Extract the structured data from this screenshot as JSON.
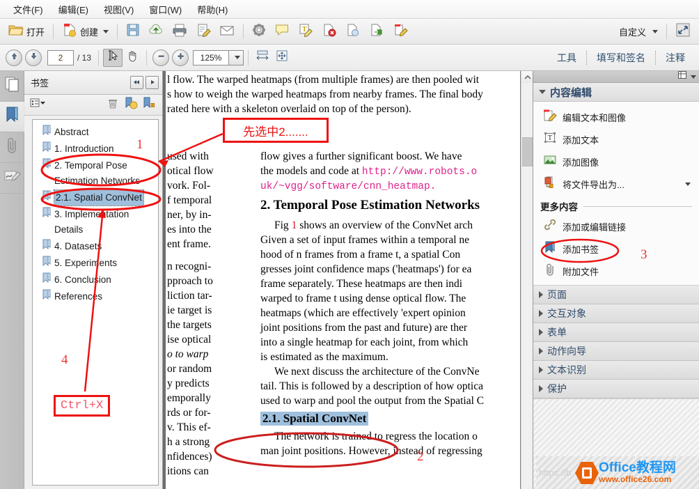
{
  "menubar": {
    "items": [
      {
        "label": "文件(F)",
        "name": "menu-file"
      },
      {
        "label": "编辑(E)",
        "name": "menu-edit"
      },
      {
        "label": "视图(V)",
        "name": "menu-view"
      },
      {
        "label": "窗口(W)",
        "name": "menu-window"
      },
      {
        "label": "帮助(H)",
        "name": "menu-help"
      }
    ]
  },
  "toolbar": {
    "open_label": "打开",
    "create_label": "创建",
    "customize_label": "自定义",
    "icons": [
      "save-icon",
      "upload-cloud-icon",
      "print-icon",
      "sign-icon",
      "email-icon",
      "settings-icon",
      "comment-icon",
      "highlight-text-icon",
      "delete-page-icon",
      "copy-page-icon",
      "export-page-icon",
      "edit-page-icon"
    ],
    "fullscreen_icon": "fullscreen-icon"
  },
  "navbar": {
    "prev_page_icon": "arrow-up-icon",
    "next_page_icon": "arrow-down-icon",
    "page_current": "2",
    "page_total": "/ 13",
    "select_tool_icon": "select-text-icon",
    "hand_tool_icon": "hand-icon",
    "zoom_out_icon": "minus-icon",
    "zoom_in_icon": "plus-icon",
    "zoom_value": "125%",
    "fit_width_icon": "fit-width-icon",
    "fit_page_icon": "fit-page-icon",
    "tabs": [
      {
        "label": "工具",
        "name": "nav-tab-tools"
      },
      {
        "label": "填写和签名",
        "name": "nav-tab-fill-sign"
      },
      {
        "label": "注释",
        "name": "nav-tab-comment"
      }
    ]
  },
  "rail": {
    "items": [
      {
        "name": "sidebar-rail-pages",
        "icon": "pages-thumbnail-icon",
        "active": false
      },
      {
        "name": "sidebar-rail-bookmarks",
        "icon": "bookmark-icon",
        "active": true
      },
      {
        "name": "sidebar-rail-attachments",
        "icon": "paperclip-icon",
        "active": false
      },
      {
        "name": "sidebar-rail-signatures",
        "icon": "signature-icon",
        "active": false
      }
    ]
  },
  "bookmarks_panel": {
    "title": "书签",
    "nav_prev_icon": "collapse-left-icon",
    "nav_next_icon": "expand-right-icon",
    "options_icon": "options-list-icon",
    "delete_icon": "trash-icon",
    "new_bookmark_icon": "new-bookmark-icon",
    "edit_bookmark_icon": "goto-bookmark-icon",
    "items": [
      {
        "label": "Abstract",
        "selected": false
      },
      {
        "label": "1. Introduction",
        "selected": false
      },
      {
        "label": "2. Temporal Pose Estimation Networks",
        "selected": false
      },
      {
        "label": "2.1. Spatial ConvNet",
        "selected": true
      },
      {
        "label": "3. Implementation Details",
        "selected": false
      },
      {
        "label": "4. Datasets",
        "selected": false
      },
      {
        "label": "5. Experiments",
        "selected": false
      },
      {
        "label": "6. Conclusion",
        "selected": false
      },
      {
        "label": "References",
        "selected": false
      }
    ]
  },
  "document": {
    "top_lines": [
      "l flow. The warped heatmaps (from multiple frames) are then pooled wit",
      "s how to weigh the warped heatmaps from nearby frames. The final body",
      "rated here with a skeleton overlaid on top of the person)."
    ],
    "left_column": [
      "used with",
      "otical flow",
      "vork. Fol-",
      "f temporal",
      "ner, by in-",
      "es into the",
      "ent frame.",
      "n recogni-",
      "pproach to",
      "liction tar-",
      "ie target is",
      "the targets",
      "ise optical",
      "o to warp",
      "or random",
      "y predicts",
      "emporally",
      "rds or for-",
      "v. This ef-",
      "h a strong",
      "nfidences)",
      "itions can"
    ],
    "right_column_para1": [
      "flow gives a further significant boost.  We have",
      "the models and code at "
    ],
    "right_column_link1": "http://www.robots.o",
    "right_column_link2": "uk/~vgg/software/cnn_heatmap.",
    "heading_2": "2. Temporal Pose Estimation Networks",
    "para_2_lines": [
      "Fig 1 shows an overview of the ConvNet arch",
      "Given a set of input frames within a temporal ne",
      "hood of n frames from a frame t, a spatial Con",
      "gresses joint confidence maps ('heatmaps') for ea",
      "frame separately.  These heatmaps are then indi",
      "warped to frame t using dense optical flow.  The",
      "heatmaps (which are effectively 'expert opinion",
      "joint positions from the past and future) are ther",
      "into a single heatmap for each joint, from which",
      "is estimated as the maximum."
    ],
    "para_3_lines": [
      "We next discuss the architecture of the ConvNe",
      "tail. This is followed by a description of how optica",
      "used to warp and pool the output from the Spatial C"
    ],
    "heading_2_1": "2.1. Spatial ConvNet",
    "para_4_lines": [
      "The network is trained to regress the location o",
      "man joint positions. However, instead of regressing"
    ]
  },
  "right_panel": {
    "view_options_icon": "panel-view-icon",
    "sections": [
      {
        "title": "内容编辑",
        "expanded": true,
        "rows": [
          {
            "label": "编辑文本和图像",
            "icon": "edit-text-image-icon",
            "has_dropdown": false
          },
          {
            "label": "添加文本",
            "icon": "add-text-icon",
            "has_dropdown": false
          },
          {
            "label": "添加图像",
            "icon": "add-image-icon",
            "has_dropdown": false
          },
          {
            "label": "将文件导出为...",
            "icon": "export-file-icon",
            "has_dropdown": true
          }
        ],
        "subtitle": "更多内容",
        "more_rows": [
          {
            "label": "添加或编辑链接",
            "icon": "link-icon",
            "has_dropdown": false
          },
          {
            "label": "添加书签",
            "icon": "add-bookmark-icon",
            "has_dropdown": false
          },
          {
            "label": "附加文件",
            "icon": "attach-file-icon",
            "has_dropdown": false
          }
        ]
      }
    ],
    "collapsed_sections": [
      {
        "title": "页面",
        "name": "rp-section-pages"
      },
      {
        "title": "交互对象",
        "name": "rp-section-interactive"
      },
      {
        "title": "表单",
        "name": "rp-section-forms"
      },
      {
        "title": "动作向导",
        "name": "rp-section-action-wizard"
      },
      {
        "title": "文本识别",
        "name": "rp-section-ocr"
      },
      {
        "title": "保护",
        "name": "rp-section-protect"
      }
    ]
  },
  "annotations": {
    "callout_text": "先选中2.......",
    "num_1": "1",
    "num_2": "2",
    "num_3": "3",
    "num_4": "4",
    "shortcut": "Ctrl+X",
    "accent_color": "#ee1111"
  },
  "watermark": {
    "brand_cn": "Office教程网",
    "url": "www.office26.com",
    "faint_url": "https://b"
  }
}
